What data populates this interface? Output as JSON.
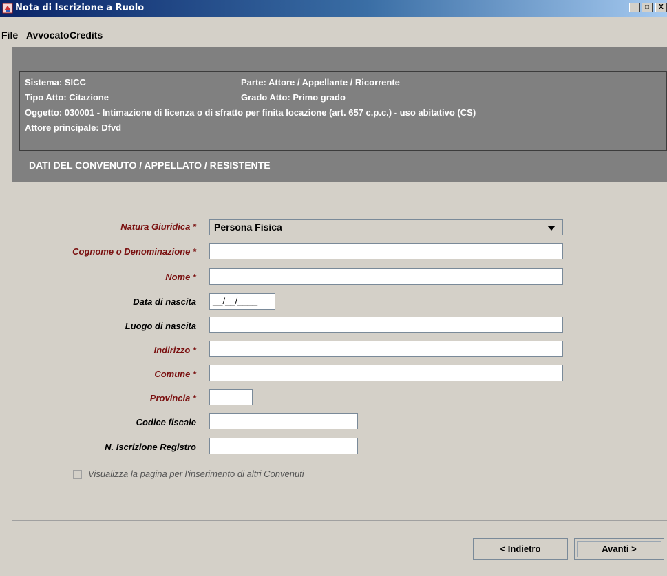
{
  "window": {
    "title": "Nota di Iscrizione a Ruolo",
    "minimize_glyph": "_",
    "maximize_glyph": "□",
    "close_glyph": "X",
    "app_icon": "app-icon"
  },
  "menu": [
    "File",
    "Avvocato",
    "Credits"
  ],
  "info": {
    "sistema": "Sistema: SICC",
    "parte": "Parte: Attore / Appellante / Ricorrente",
    "tipo_atto": "Tipo Atto: Citazione",
    "grado_atto": "Grado Atto: Primo grado",
    "oggetto": "Oggetto: 030001 - Intimazione di licenza o di sfratto per finita locazione (art. 657 c.p.c.) - uso abitativo (CS)",
    "attore": "Attore principale: Dfvd"
  },
  "section_title": "DATI DEL CONVENUTO / APPELLATO / RESISTENTE",
  "form": {
    "natura_giuridica": {
      "label": "Natura Giuridica *",
      "value": "Persona Fisica"
    },
    "cognome": {
      "label": "Cognome o Denominazione *",
      "value": ""
    },
    "nome": {
      "label": "Nome *",
      "value": ""
    },
    "data_nascita": {
      "label": "Data di nascita",
      "value": "__/__/____"
    },
    "luogo_nascita": {
      "label": "Luogo di nascita",
      "value": ""
    },
    "indirizzo": {
      "label": "Indirizzo *",
      "value": ""
    },
    "comune": {
      "label": "Comune *",
      "value": ""
    },
    "provincia": {
      "label": "Provincia *",
      "value": ""
    },
    "codice_fiscale": {
      "label": "Codice fiscale",
      "value": ""
    },
    "iscrizione_registro": {
      "label": "N. Iscrizione Registro",
      "value": ""
    },
    "altri_convenuti": {
      "label": "Visualizza la pagina per l'inserimento di altri Convenuti",
      "checked": false
    }
  },
  "buttons": {
    "back": "< Indietro",
    "next": "Avanti >"
  },
  "colors": {
    "required_label": "#7a1010",
    "info_band": "#808080",
    "window_bg": "#d4d0c8",
    "titlebar_start": "#0a2468"
  }
}
